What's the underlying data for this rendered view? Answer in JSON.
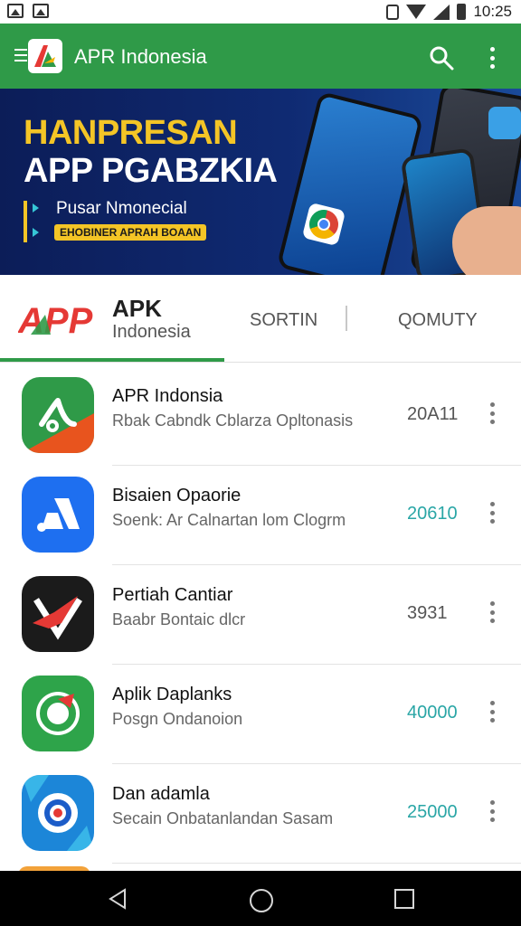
{
  "status_bar": {
    "time": "10:25"
  },
  "app_bar": {
    "title": "APR Indonesia"
  },
  "banner": {
    "title_line1": "HANPRESAN",
    "title_line2": "APP PGABZKIA",
    "subtitle": "Pusar Nmonecial",
    "pill_text": "EHOBINER APRAH BOAAN"
  },
  "tabs": {
    "brand_logo_text": "APP",
    "brand_name": "APK",
    "brand_sub": "Indonesia",
    "items": [
      {
        "label": "SORTIN"
      },
      {
        "label": "QOMUTY"
      }
    ]
  },
  "apps": [
    {
      "name": "APR Indonsia",
      "desc": "Rbak Cabndk Cblarza Opltonasis",
      "count": "20A11",
      "count_color": "#555555",
      "icon": "green-curve-icon"
    },
    {
      "name": "Bisaien Opaorie",
      "desc": "Soenk: Ar Calnartan lom Clogrm",
      "count": "20610",
      "count_color": "#2aa6a6",
      "icon": "blue-arrow-icon"
    },
    {
      "name": "Pertiah Cantiar",
      "desc": "Baabr Bontaic dlcr",
      "count": "3931",
      "count_color": "#555555",
      "icon": "red-v-icon"
    },
    {
      "name": "Aplik Daplanks",
      "desc": "Posgn Ondanoion",
      "count": "40000",
      "count_color": "#2aa6a6",
      "icon": "green-g-icon"
    },
    {
      "name": "Dan adamla",
      "desc": "Secain Onbatanlandan Sasam",
      "count": "25000",
      "count_color": "#2aa6a6",
      "icon": "target-icon"
    }
  ],
  "colors": {
    "primary": "#2f9a48",
    "accent": "#f4c526"
  }
}
